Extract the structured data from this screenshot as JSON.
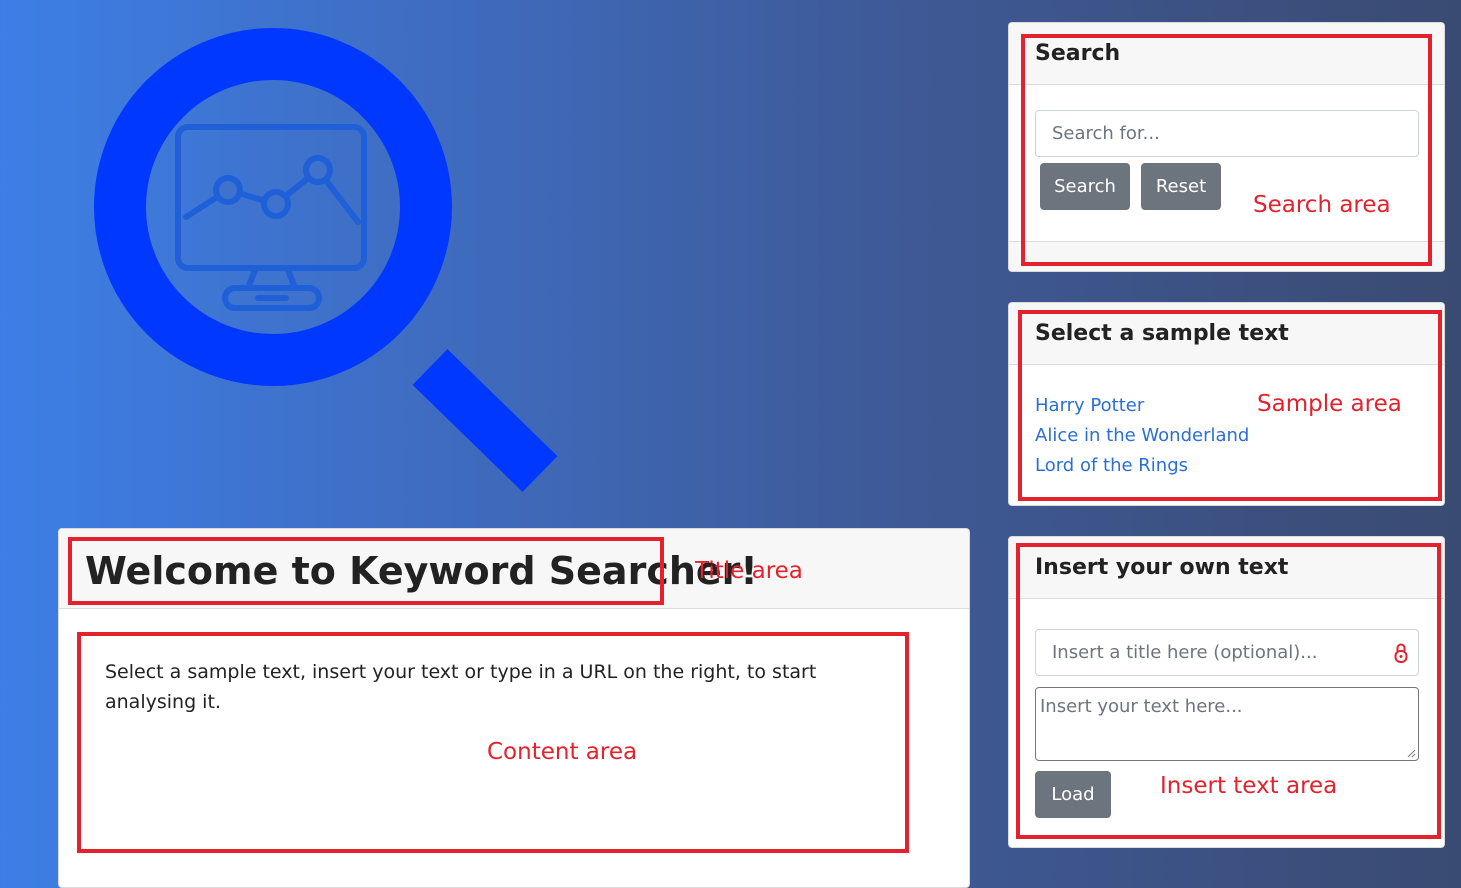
{
  "search": {
    "title": "Search",
    "placeholder": "Search for...",
    "search_button": "Search",
    "reset_button": "Reset"
  },
  "samples": {
    "title": "Select a sample text",
    "items": [
      "Harry Potter",
      "Alice in the Wonderland",
      "Lord of the Rings"
    ]
  },
  "insert": {
    "title": "Insert your own text",
    "title_placeholder": "Insert a title here (optional)...",
    "text_placeholder": "Insert your text here...",
    "load_button": "Load"
  },
  "main": {
    "title": "Welcome to Keyword Searcher!",
    "intro": "Select a sample text, insert your text or type in a URL on the right, to start analysing it."
  },
  "annotations": {
    "search_area": "Search area",
    "sample_area": "Sample area",
    "insert_area": "Insert text area",
    "title_area": "Title area",
    "content_area": "Content area"
  },
  "colors": {
    "highlight": "#e3222d",
    "link": "#2a6fd6",
    "button": "#6c757d",
    "logo": "#0038ff"
  },
  "icons": [
    "magnifier-logo-icon",
    "monitor-chart-icon",
    "password-lock-icon"
  ]
}
